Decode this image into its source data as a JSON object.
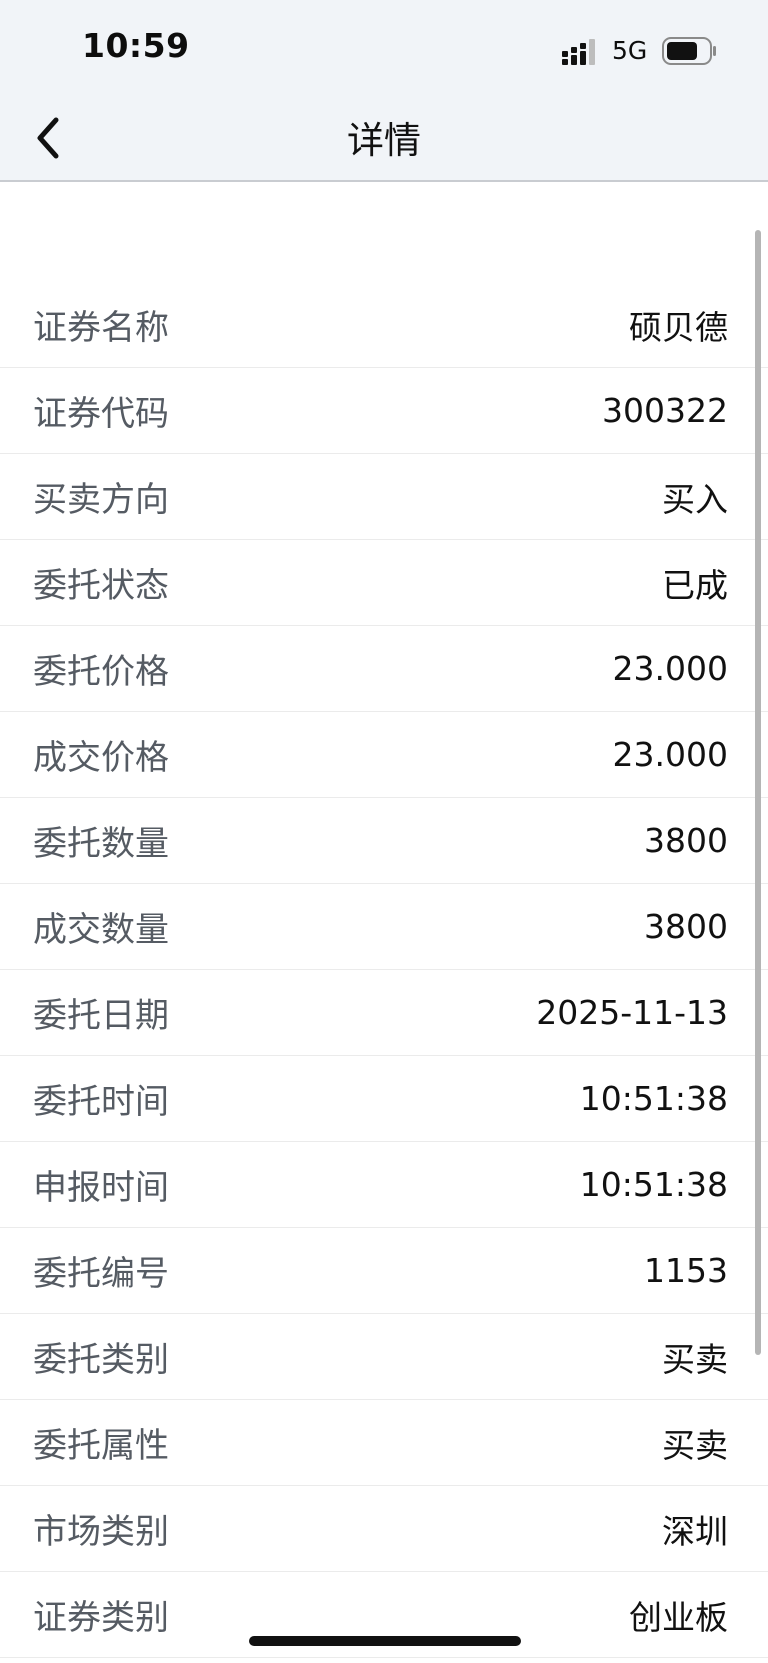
{
  "status_bar": {
    "time": "10:59",
    "network": "5G"
  },
  "nav": {
    "title": "详情",
    "back_icon": "chevron-left-icon"
  },
  "details": [
    {
      "label": "证券名称",
      "value": "硕贝德"
    },
    {
      "label": "证券代码",
      "value": "300322"
    },
    {
      "label": "买卖方向",
      "value": "买入"
    },
    {
      "label": "委托状态",
      "value": "已成"
    },
    {
      "label": "委托价格",
      "value": "23.000"
    },
    {
      "label": "成交价格",
      "value": "23.000"
    },
    {
      "label": "委托数量",
      "value": "3800"
    },
    {
      "label": "成交数量",
      "value": "3800"
    },
    {
      "label": "委托日期",
      "value": "2025-11-13"
    },
    {
      "label": "委托时间",
      "value": "10:51:38"
    },
    {
      "label": "申报时间",
      "value": "10:51:38"
    },
    {
      "label": "委托编号",
      "value": "1153"
    },
    {
      "label": "委托类别",
      "value": "买卖"
    },
    {
      "label": "委托属性",
      "value": "买卖"
    },
    {
      "label": "市场类别",
      "value": "深圳"
    },
    {
      "label": "证券类别",
      "value": "创业板"
    }
  ]
}
